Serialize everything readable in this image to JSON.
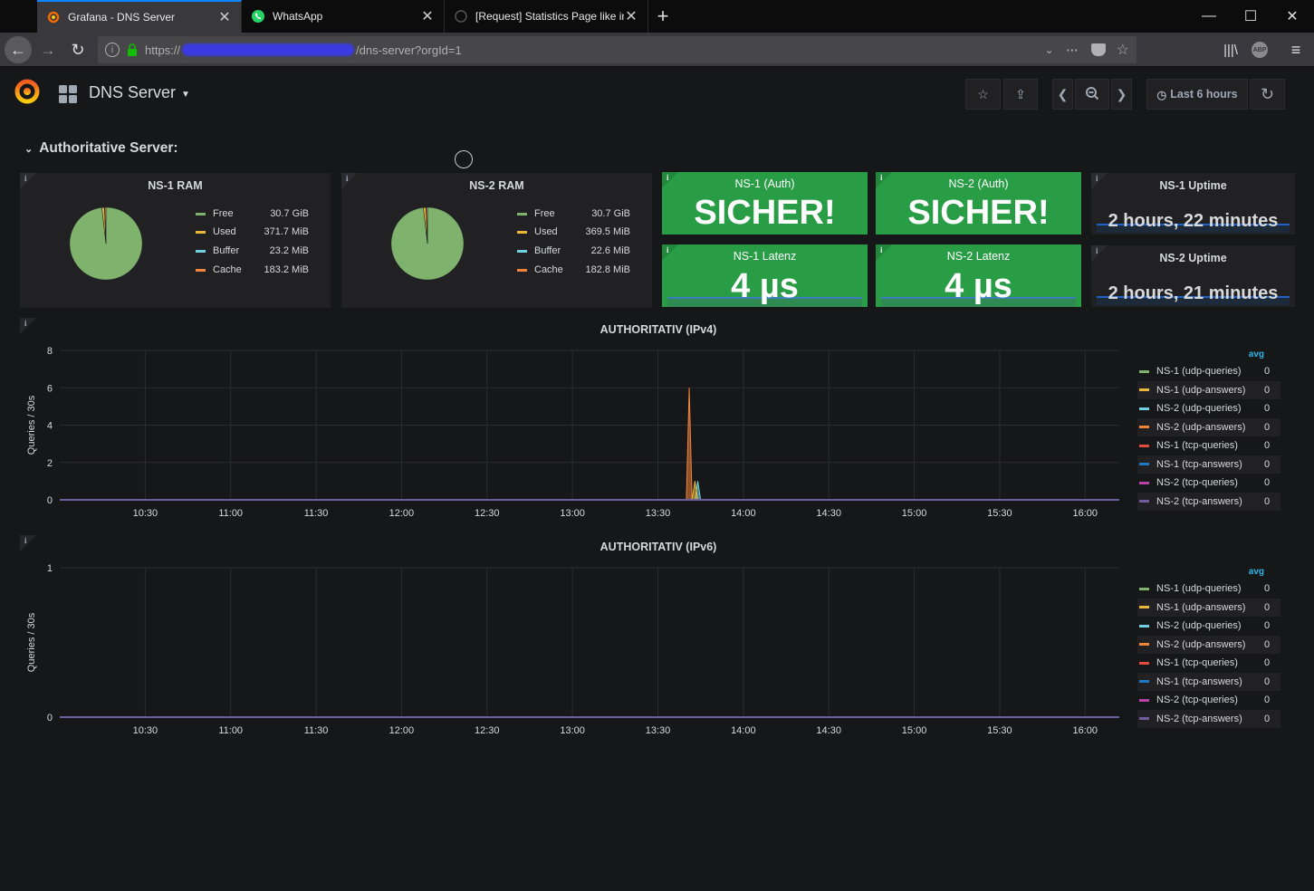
{
  "browser": {
    "tabs": [
      {
        "title": "Grafana - DNS Server",
        "icon": "grafana-icon",
        "active": true
      },
      {
        "title": "WhatsApp",
        "icon": "whatsapp-icon",
        "active": false
      },
      {
        "title": "[Request] Statistics Page like in",
        "icon": "github-icon",
        "active": false
      }
    ],
    "url_prefix": "https://",
    "url_suffix": "/dns-server?orgId=1"
  },
  "dashboard": {
    "title": "DNS Server",
    "time_range": "Last 6 hours",
    "row_title": "Authoritative Server:"
  },
  "ram_panels": [
    {
      "title": "NS-1 RAM",
      "legend": [
        {
          "label": "Free",
          "value": "30.7 GiB",
          "color": "#7eb26d"
        },
        {
          "label": "Used",
          "value": "371.7 MiB",
          "color": "#eab839"
        },
        {
          "label": "Buffer",
          "value": "23.2 MiB",
          "color": "#6ed0e0"
        },
        {
          "label": "Cache",
          "value": "183.2 MiB",
          "color": "#ef843c"
        }
      ]
    },
    {
      "title": "NS-2 RAM",
      "legend": [
        {
          "label": "Free",
          "value": "30.7 GiB",
          "color": "#7eb26d"
        },
        {
          "label": "Used",
          "value": "369.5 MiB",
          "color": "#eab839"
        },
        {
          "label": "Buffer",
          "value": "22.6 MiB",
          "color": "#6ed0e0"
        },
        {
          "label": "Cache",
          "value": "182.8 MiB",
          "color": "#ef843c"
        }
      ]
    }
  ],
  "stat_panels": {
    "ns1_auth": {
      "title": "NS-1 (Auth)",
      "value": "SICHER!"
    },
    "ns2_auth": {
      "title": "NS-2 (Auth)",
      "value": "SICHER!"
    },
    "ns1_latency": {
      "title": "NS-1 Latenz",
      "value": "4 µs"
    },
    "ns2_latency": {
      "title": "NS-2 Latenz",
      "value": "4 µs"
    },
    "ns1_uptime": {
      "title": "NS-1 Uptime",
      "value": "2 hours, 22 minutes"
    },
    "ns2_uptime": {
      "title": "NS-2 Uptime",
      "value": "2 hours, 21 minutes"
    }
  },
  "graphs": {
    "legend_header": "avg",
    "x_ticks": [
      "10:30",
      "11:00",
      "11:30",
      "12:00",
      "12:30",
      "13:00",
      "13:30",
      "14:00",
      "14:30",
      "15:00",
      "15:30",
      "16:00"
    ],
    "series": [
      {
        "name": "NS-1 (udp-queries)",
        "avg": "0",
        "color": "#7eb26d"
      },
      {
        "name": "NS-1 (udp-answers)",
        "avg": "0",
        "color": "#eab839"
      },
      {
        "name": "NS-2 (udp-queries)",
        "avg": "0",
        "color": "#6ed0e0"
      },
      {
        "name": "NS-2 (udp-answers)",
        "avg": "0",
        "color": "#ef843c"
      },
      {
        "name": "NS-1 (tcp-queries)",
        "avg": "0",
        "color": "#e24d42"
      },
      {
        "name": "NS-1 (tcp-answers)",
        "avg": "0",
        "color": "#1f78c1"
      },
      {
        "name": "NS-2 (tcp-queries)",
        "avg": "0",
        "color": "#ba43a9"
      },
      {
        "name": "NS-2 (tcp-answers)",
        "avg": "0",
        "color": "#705da0"
      }
    ],
    "ipv4": {
      "title": "AUTHORITATIV (IPv4)",
      "ylabel": "Queries / 30s",
      "y_ticks": [
        "0",
        "2",
        "4",
        "6",
        "8"
      ]
    },
    "ipv6": {
      "title": "AUTHORITATIV (IPv6)",
      "ylabel": "Queries / 30s",
      "y_ticks": [
        "0",
        "1"
      ]
    }
  },
  "chart_data": [
    {
      "type": "pie",
      "title": "NS-1 RAM",
      "categories": [
        "Free",
        "Used",
        "Buffer",
        "Cache"
      ],
      "values_mib": [
        31437,
        371.7,
        23.2,
        183.2
      ]
    },
    {
      "type": "pie",
      "title": "NS-2 RAM",
      "categories": [
        "Free",
        "Used",
        "Buffer",
        "Cache"
      ],
      "values_mib": [
        31437,
        369.5,
        22.6,
        182.8
      ]
    },
    {
      "type": "area",
      "title": "AUTHORITATIV (IPv4)",
      "ylabel": "Queries / 30s",
      "ylim": [
        0,
        8
      ],
      "xlim": [
        "10:00",
        "16:12"
      ],
      "series": [
        {
          "name": "NS-2 (udp-answers)",
          "x": [
            "13:40",
            "13:41",
            "13:42",
            "13:43"
          ],
          "y": [
            0,
            6,
            0,
            0
          ]
        },
        {
          "name": "NS-2 (udp-queries)",
          "x": [
            "13:43",
            "13:44",
            "13:45"
          ],
          "y": [
            0,
            1,
            0
          ]
        },
        {
          "name": "NS-1 (udp-answers)",
          "x": [
            "13:42",
            "13:43",
            "13:44"
          ],
          "y": [
            0,
            1,
            0
          ]
        }
      ]
    },
    {
      "type": "line",
      "title": "AUTHORITATIV (IPv6)",
      "ylabel": "Queries / 30s",
      "ylim": [
        0,
        1
      ],
      "xlim": [
        "10:00",
        "16:12"
      ],
      "series": []
    }
  ]
}
